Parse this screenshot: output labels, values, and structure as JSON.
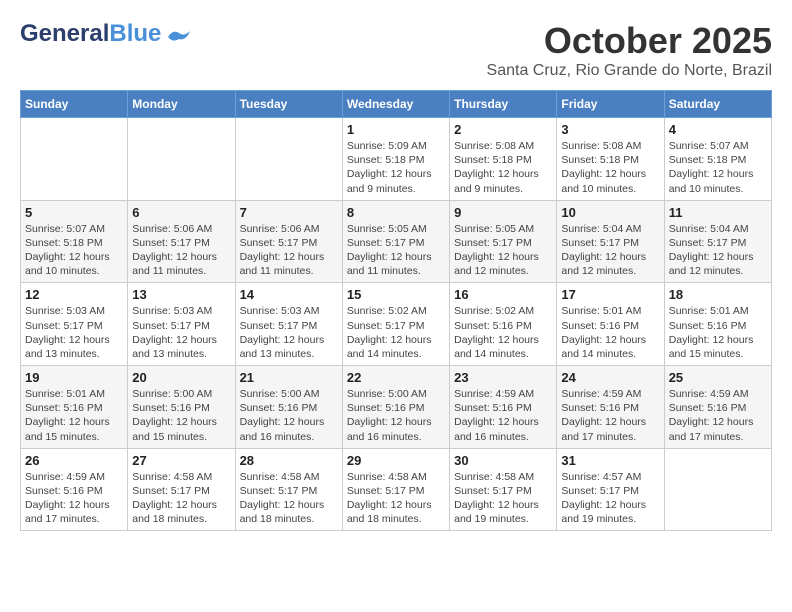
{
  "header": {
    "logo_general": "General",
    "logo_blue": "Blue",
    "month_title": "October 2025",
    "subtitle": "Santa Cruz, Rio Grande do Norte, Brazil"
  },
  "days_of_week": [
    "Sunday",
    "Monday",
    "Tuesday",
    "Wednesday",
    "Thursday",
    "Friday",
    "Saturday"
  ],
  "weeks": [
    [
      {
        "day": "",
        "info": ""
      },
      {
        "day": "",
        "info": ""
      },
      {
        "day": "",
        "info": ""
      },
      {
        "day": "1",
        "info": "Sunrise: 5:09 AM\nSunset: 5:18 PM\nDaylight: 12 hours\nand 9 minutes."
      },
      {
        "day": "2",
        "info": "Sunrise: 5:08 AM\nSunset: 5:18 PM\nDaylight: 12 hours\nand 9 minutes."
      },
      {
        "day": "3",
        "info": "Sunrise: 5:08 AM\nSunset: 5:18 PM\nDaylight: 12 hours\nand 10 minutes."
      },
      {
        "day": "4",
        "info": "Sunrise: 5:07 AM\nSunset: 5:18 PM\nDaylight: 12 hours\nand 10 minutes."
      }
    ],
    [
      {
        "day": "5",
        "info": "Sunrise: 5:07 AM\nSunset: 5:18 PM\nDaylight: 12 hours\nand 10 minutes."
      },
      {
        "day": "6",
        "info": "Sunrise: 5:06 AM\nSunset: 5:17 PM\nDaylight: 12 hours\nand 11 minutes."
      },
      {
        "day": "7",
        "info": "Sunrise: 5:06 AM\nSunset: 5:17 PM\nDaylight: 12 hours\nand 11 minutes."
      },
      {
        "day": "8",
        "info": "Sunrise: 5:05 AM\nSunset: 5:17 PM\nDaylight: 12 hours\nand 11 minutes."
      },
      {
        "day": "9",
        "info": "Sunrise: 5:05 AM\nSunset: 5:17 PM\nDaylight: 12 hours\nand 12 minutes."
      },
      {
        "day": "10",
        "info": "Sunrise: 5:04 AM\nSunset: 5:17 PM\nDaylight: 12 hours\nand 12 minutes."
      },
      {
        "day": "11",
        "info": "Sunrise: 5:04 AM\nSunset: 5:17 PM\nDaylight: 12 hours\nand 12 minutes."
      }
    ],
    [
      {
        "day": "12",
        "info": "Sunrise: 5:03 AM\nSunset: 5:17 PM\nDaylight: 12 hours\nand 13 minutes."
      },
      {
        "day": "13",
        "info": "Sunrise: 5:03 AM\nSunset: 5:17 PM\nDaylight: 12 hours\nand 13 minutes."
      },
      {
        "day": "14",
        "info": "Sunrise: 5:03 AM\nSunset: 5:17 PM\nDaylight: 12 hours\nand 13 minutes."
      },
      {
        "day": "15",
        "info": "Sunrise: 5:02 AM\nSunset: 5:17 PM\nDaylight: 12 hours\nand 14 minutes."
      },
      {
        "day": "16",
        "info": "Sunrise: 5:02 AM\nSunset: 5:16 PM\nDaylight: 12 hours\nand 14 minutes."
      },
      {
        "day": "17",
        "info": "Sunrise: 5:01 AM\nSunset: 5:16 PM\nDaylight: 12 hours\nand 14 minutes."
      },
      {
        "day": "18",
        "info": "Sunrise: 5:01 AM\nSunset: 5:16 PM\nDaylight: 12 hours\nand 15 minutes."
      }
    ],
    [
      {
        "day": "19",
        "info": "Sunrise: 5:01 AM\nSunset: 5:16 PM\nDaylight: 12 hours\nand 15 minutes."
      },
      {
        "day": "20",
        "info": "Sunrise: 5:00 AM\nSunset: 5:16 PM\nDaylight: 12 hours\nand 15 minutes."
      },
      {
        "day": "21",
        "info": "Sunrise: 5:00 AM\nSunset: 5:16 PM\nDaylight: 12 hours\nand 16 minutes."
      },
      {
        "day": "22",
        "info": "Sunrise: 5:00 AM\nSunset: 5:16 PM\nDaylight: 12 hours\nand 16 minutes."
      },
      {
        "day": "23",
        "info": "Sunrise: 4:59 AM\nSunset: 5:16 PM\nDaylight: 12 hours\nand 16 minutes."
      },
      {
        "day": "24",
        "info": "Sunrise: 4:59 AM\nSunset: 5:16 PM\nDaylight: 12 hours\nand 17 minutes."
      },
      {
        "day": "25",
        "info": "Sunrise: 4:59 AM\nSunset: 5:16 PM\nDaylight: 12 hours\nand 17 minutes."
      }
    ],
    [
      {
        "day": "26",
        "info": "Sunrise: 4:59 AM\nSunset: 5:16 PM\nDaylight: 12 hours\nand 17 minutes."
      },
      {
        "day": "27",
        "info": "Sunrise: 4:58 AM\nSunset: 5:17 PM\nDaylight: 12 hours\nand 18 minutes."
      },
      {
        "day": "28",
        "info": "Sunrise: 4:58 AM\nSunset: 5:17 PM\nDaylight: 12 hours\nand 18 minutes."
      },
      {
        "day": "29",
        "info": "Sunrise: 4:58 AM\nSunset: 5:17 PM\nDaylight: 12 hours\nand 18 minutes."
      },
      {
        "day": "30",
        "info": "Sunrise: 4:58 AM\nSunset: 5:17 PM\nDaylight: 12 hours\nand 19 minutes."
      },
      {
        "day": "31",
        "info": "Sunrise: 4:57 AM\nSunset: 5:17 PM\nDaylight: 12 hours\nand 19 minutes."
      },
      {
        "day": "",
        "info": ""
      }
    ]
  ]
}
